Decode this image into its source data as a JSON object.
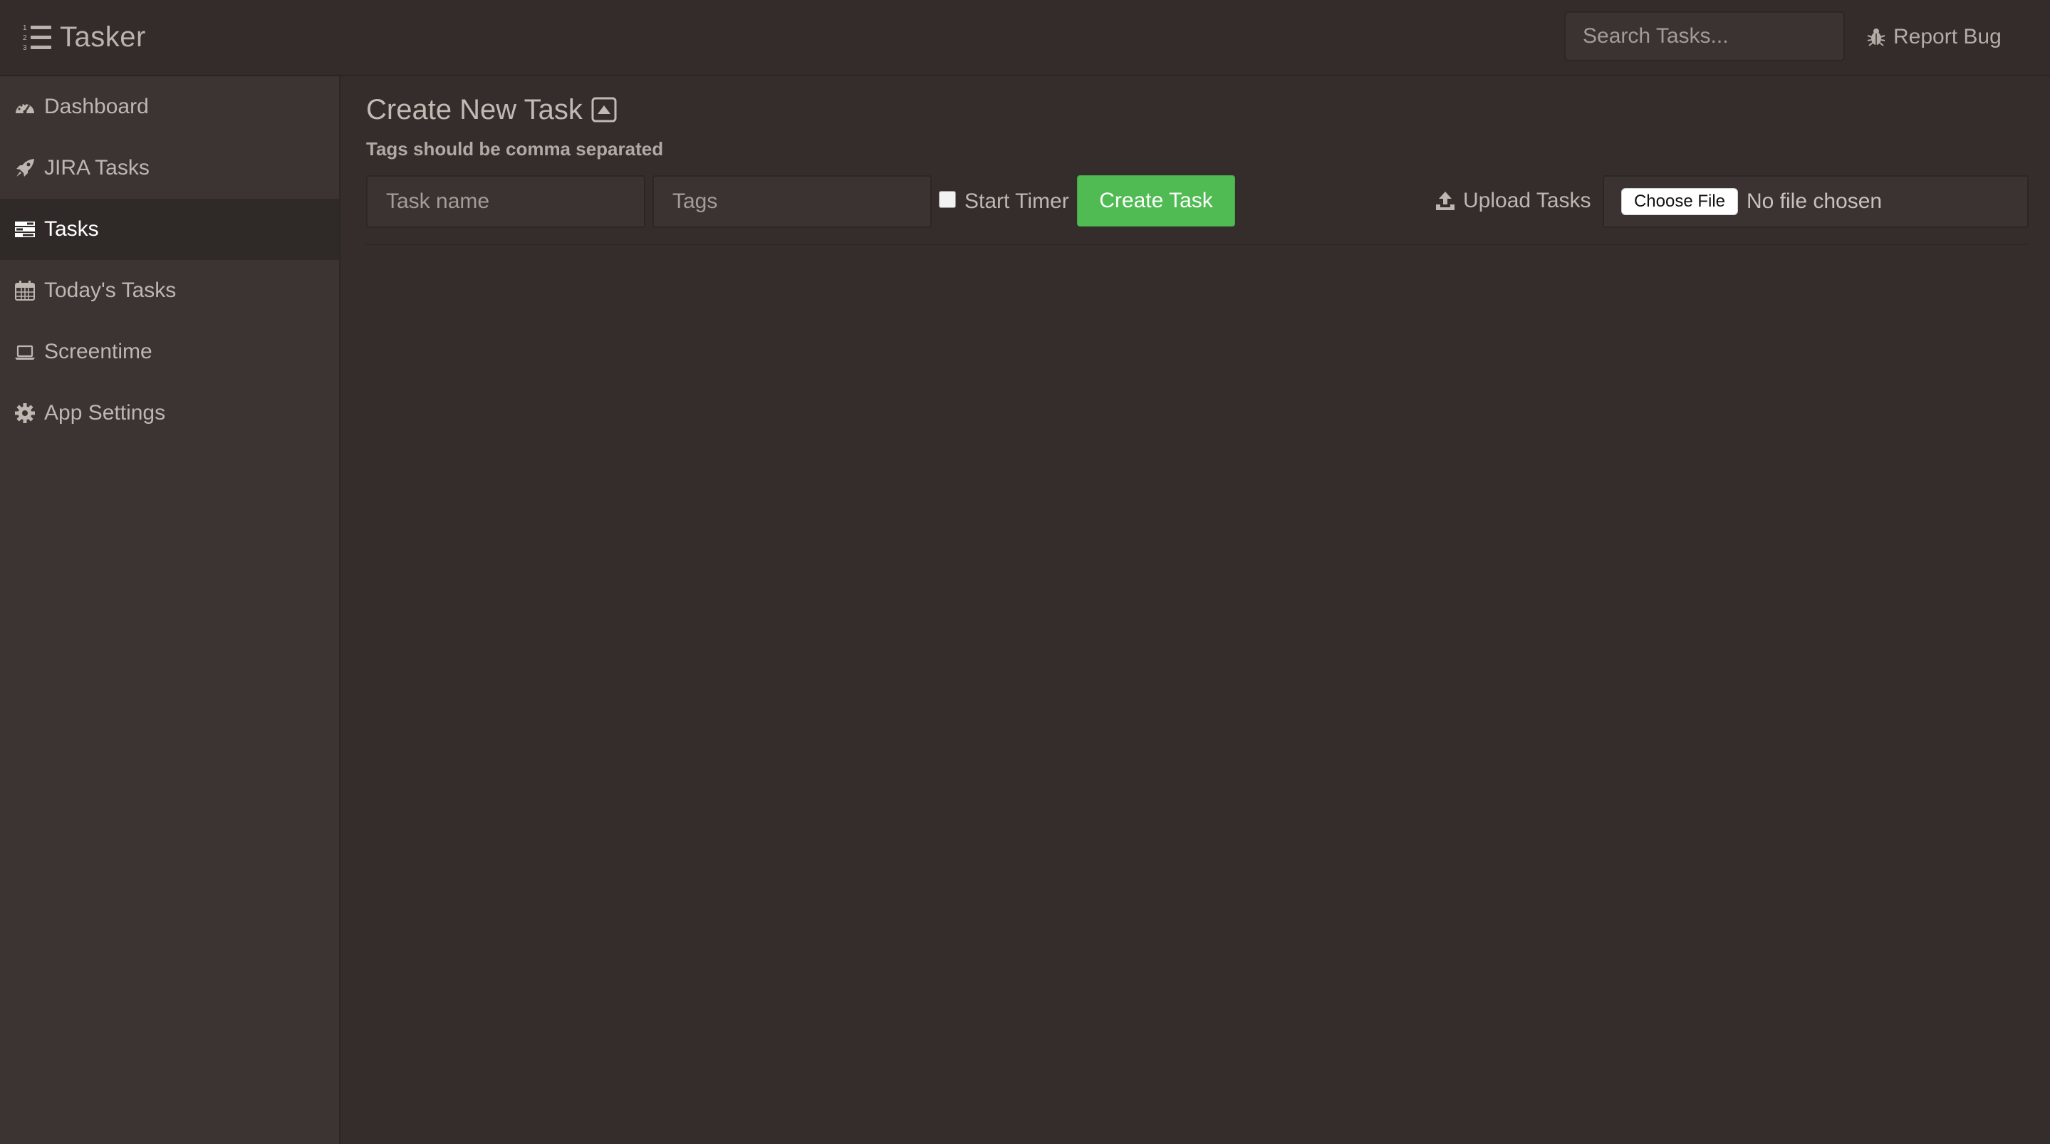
{
  "navbar": {
    "brand_label": "Tasker",
    "brand_icon": "ordered-list-icon",
    "search_placeholder": "Search Tasks...",
    "report_bug_label": "Report Bug",
    "report_bug_icon": "bug-icon"
  },
  "sidebar": {
    "items": [
      {
        "label": "Dashboard",
        "icon": "dashboard-icon",
        "active": false
      },
      {
        "label": "JIRA Tasks",
        "icon": "rocket-icon",
        "active": false
      },
      {
        "label": "Tasks",
        "icon": "tasks-icon",
        "active": true
      },
      {
        "label": "Today's Tasks",
        "icon": "calendar-icon",
        "active": false
      },
      {
        "label": "Screentime",
        "icon": "laptop-icon",
        "active": false
      },
      {
        "label": "App Settings",
        "icon": "gear-icon",
        "active": false
      }
    ]
  },
  "main": {
    "title": "Create New Task",
    "title_icon": "collapse-up-icon",
    "hint": "Tags should be comma separated",
    "task_name_placeholder": "Task name",
    "tags_placeholder": "Tags",
    "start_timer_label": "Start Timer",
    "start_timer_checked": false,
    "create_button_label": "Create Task",
    "upload_label": "Upload Tasks",
    "upload_icon": "upload-icon",
    "choose_file_label": "Choose File",
    "file_status": "No file chosen"
  },
  "colors": {
    "background": "#342d2b",
    "sidebar": "#3b3432",
    "active_item": "#2f2927",
    "accent_green": "#4fbb52"
  }
}
